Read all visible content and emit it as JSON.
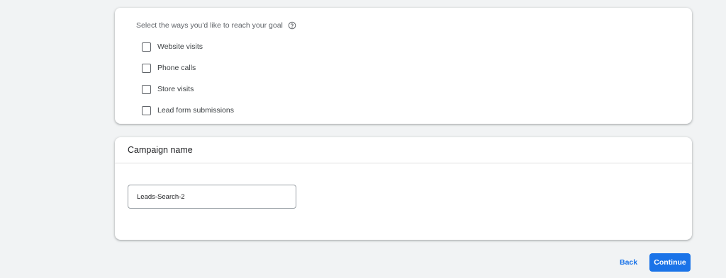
{
  "goal_section": {
    "prompt": "Select the ways you'd like to reach your goal",
    "help_icon": "help-circle-icon",
    "options": [
      {
        "label": "Website visits",
        "checked": false
      },
      {
        "label": "Phone calls",
        "checked": false
      },
      {
        "label": "Store visits",
        "checked": false
      },
      {
        "label": "Lead form submissions",
        "checked": false
      }
    ]
  },
  "campaign_name_section": {
    "title": "Campaign name",
    "input_value": "Leads-Search-2"
  },
  "actions": {
    "back_label": "Back",
    "continue_label": "Continue"
  },
  "colors": {
    "accent": "#1a73e8",
    "background": "#f1f3f4",
    "card": "#ffffff"
  }
}
